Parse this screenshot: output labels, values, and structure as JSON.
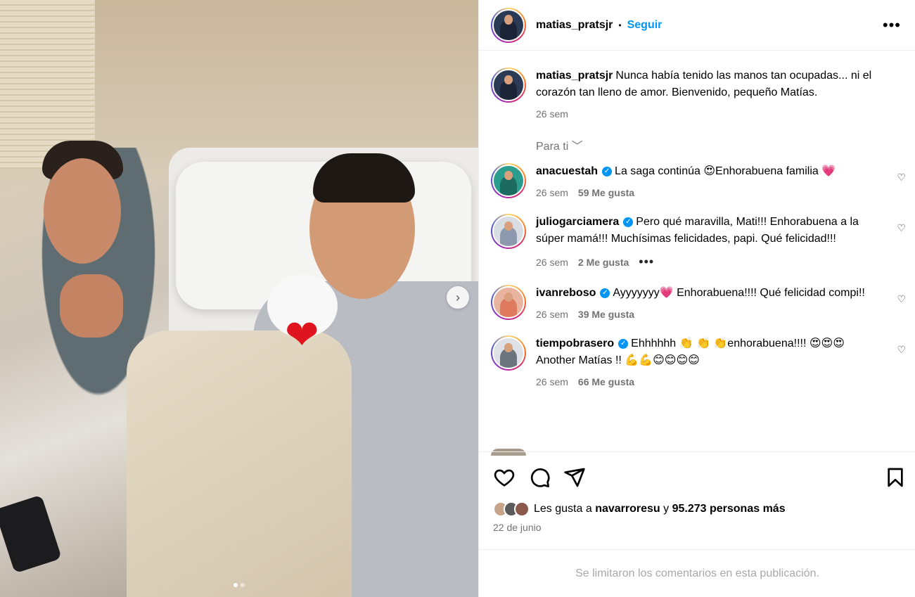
{
  "post": {
    "username": "matias_pratsjr",
    "follow_label": "Seguir",
    "separator": "•",
    "more_label": "•••",
    "caption": "Nunca había tenido las manos tan ocupadas... ni el corazón tan lleno de amor. Bienvenido, pequeño Matías.",
    "caption_time": "26 sem",
    "for_you_label": "Para ti ﹀",
    "likes_prefix": "Les gusta a",
    "liked_by_user": "navarroresu",
    "likes_connector": "y",
    "likes_rest": "95.273 personas más",
    "date": "22 de junio",
    "limited_comments": "Se limitaron los comentarios en esta publicación.",
    "next_icon": "chevron-right-icon"
  },
  "comments": [
    {
      "user": "anacuestah",
      "verified": true,
      "text": "La saga continúa 😍Enhorabuena familia 💗",
      "time": "26 sem",
      "likes": "59 Me gusta",
      "avatar_color": "#2a9d8f"
    },
    {
      "user": "juliogarciamera",
      "verified": true,
      "text": "Pero qué maravilla, Mati!!! Enhorabuena a la súper mamá!!! Muchísimas felicidades, papi. Qué felicidad!!!",
      "time": "26 sem",
      "likes": "2 Me gusta",
      "more": "•••",
      "avatar_color": "#8d99ae"
    },
    {
      "user": "ivanreboso",
      "verified": true,
      "text": "Ayyyyyyy💗  Enhorabuena!!!! Qué felicidad compi!!",
      "time": "26 sem",
      "likes": "39 Me gusta",
      "avatar_color": "#e07a5f"
    },
    {
      "user": "tiempobrasero",
      "verified": true,
      "text": "Ehhhhhh 👏 👏 👏enhorabuena!!!! 😍😍😍 Another Matías !! 💪💪😊😊😊😊",
      "time": "26 sem",
      "likes": "66 Me gusta",
      "avatar_color": "#6c757d"
    }
  ],
  "colors": {
    "accent": "#0095f6",
    "muted": "#737373",
    "heart": "#e0141e"
  }
}
